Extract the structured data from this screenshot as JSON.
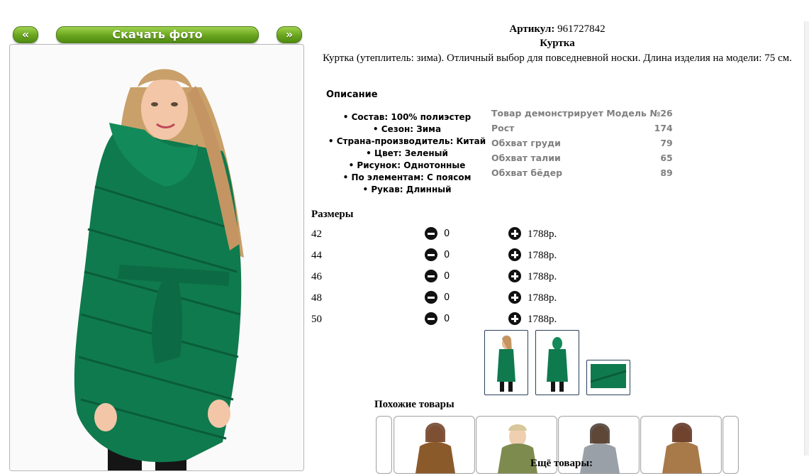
{
  "nav": {
    "prev_label": "«",
    "download_label": "Скачать фото",
    "next_label": "»"
  },
  "product": {
    "article_label": "Артикул:",
    "article_value": "961727842",
    "title": "Куртка",
    "description": "Куртка (утеплитель: зима). Отличный выбор для повседневной носки. Длина изделия на модели: 75 см."
  },
  "description_section": {
    "header": "Описание",
    "features": [
      "Состав: 100% полиэстер",
      "Сезон: Зима",
      "Страна-производитель: Китай",
      "Цвет: Зеленый",
      "Рисунок: Однотонные",
      "По элементам: С поясом",
      "Рукав: Длинный"
    ]
  },
  "model": {
    "header": "Товар демонстрирует Модель №26",
    "rows": [
      {
        "label": "Рост",
        "value": "174"
      },
      {
        "label": "Обхват груди",
        "value": "79"
      },
      {
        "label": "Обхват талии",
        "value": "65"
      },
      {
        "label": "Обхват бёдер",
        "value": "89"
      }
    ]
  },
  "sizes": {
    "header": "Размеры",
    "rows": [
      {
        "size": "42",
        "qty": "0",
        "price": "1788р."
      },
      {
        "size": "44",
        "qty": "0",
        "price": "1788р."
      },
      {
        "size": "46",
        "qty": "0",
        "price": "1788р."
      },
      {
        "size": "48",
        "qty": "0",
        "price": "1788р."
      },
      {
        "size": "50",
        "qty": "0",
        "price": "1788р."
      }
    ]
  },
  "similar": {
    "header": "Похожие товары"
  },
  "more": {
    "header": "Ещё товары:"
  },
  "colors": {
    "jacket_green": "#0f7a4e",
    "button_green": "#6aa51e"
  }
}
